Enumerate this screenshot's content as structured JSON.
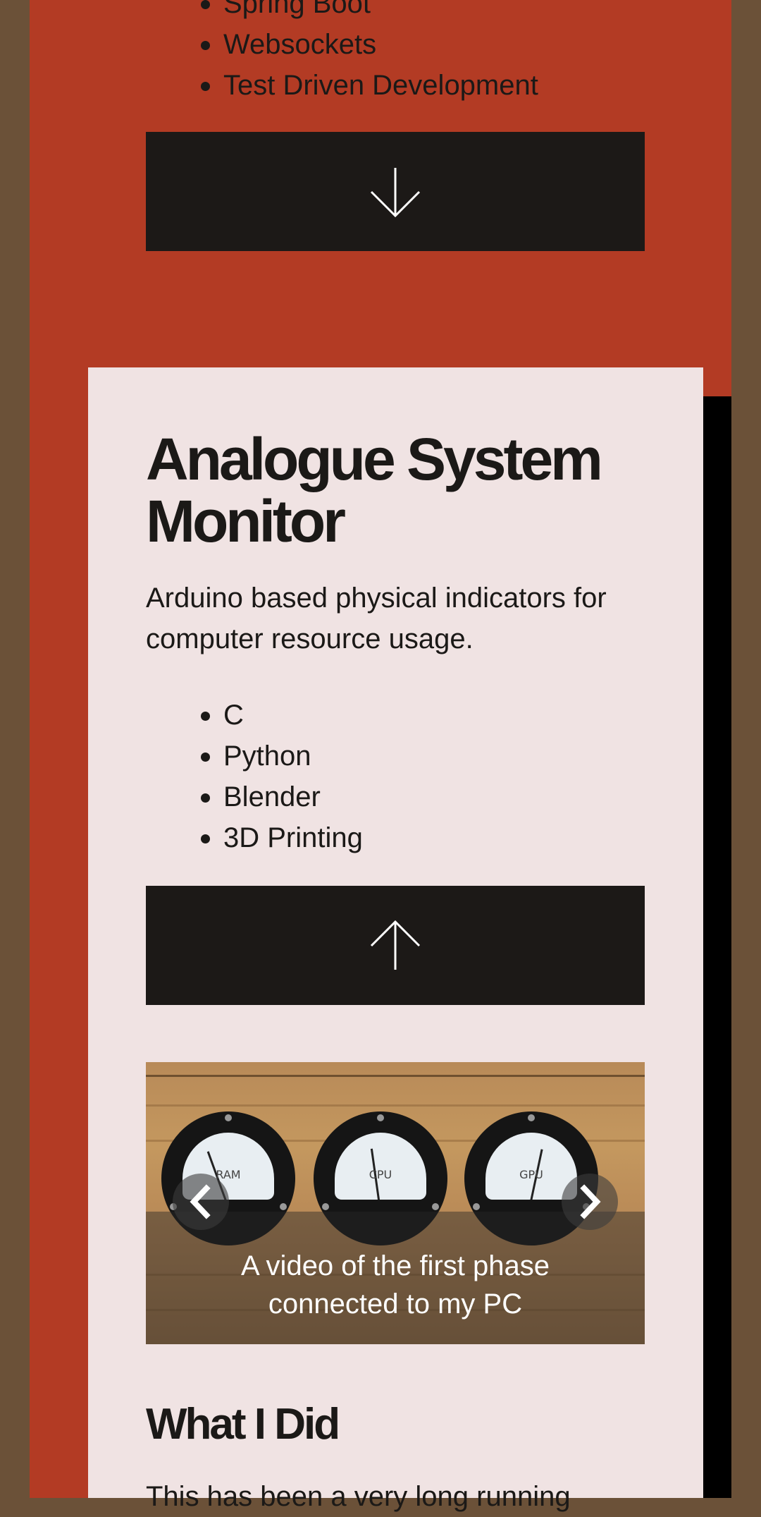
{
  "previous_project": {
    "tech_list": [
      "Spring Boot",
      "Websockets",
      "Test Driven Development"
    ],
    "toggle_icon": "arrow-down-icon"
  },
  "project": {
    "title": "Analogue System Monitor",
    "description": "Arduino based physical indicators for computer resource usage.",
    "tech_list": [
      "C",
      "Python",
      "Blender",
      "3D Printing"
    ],
    "toggle_icon": "arrow-up-icon",
    "carousel": {
      "caption": "A video of the first phase connected to my PC",
      "meter_labels": [
        "RAM",
        "CPU",
        "GPU"
      ],
      "prev_icon": "chevron-left-icon",
      "next_icon": "chevron-right-icon"
    },
    "section_heading": "What I Did",
    "body_text": "This has been a very long running"
  },
  "colors": {
    "background": "#6b5138",
    "panel": "#b33b24",
    "card": "#f0e3e3",
    "button": "#1c1917",
    "text": "#1b1917"
  }
}
